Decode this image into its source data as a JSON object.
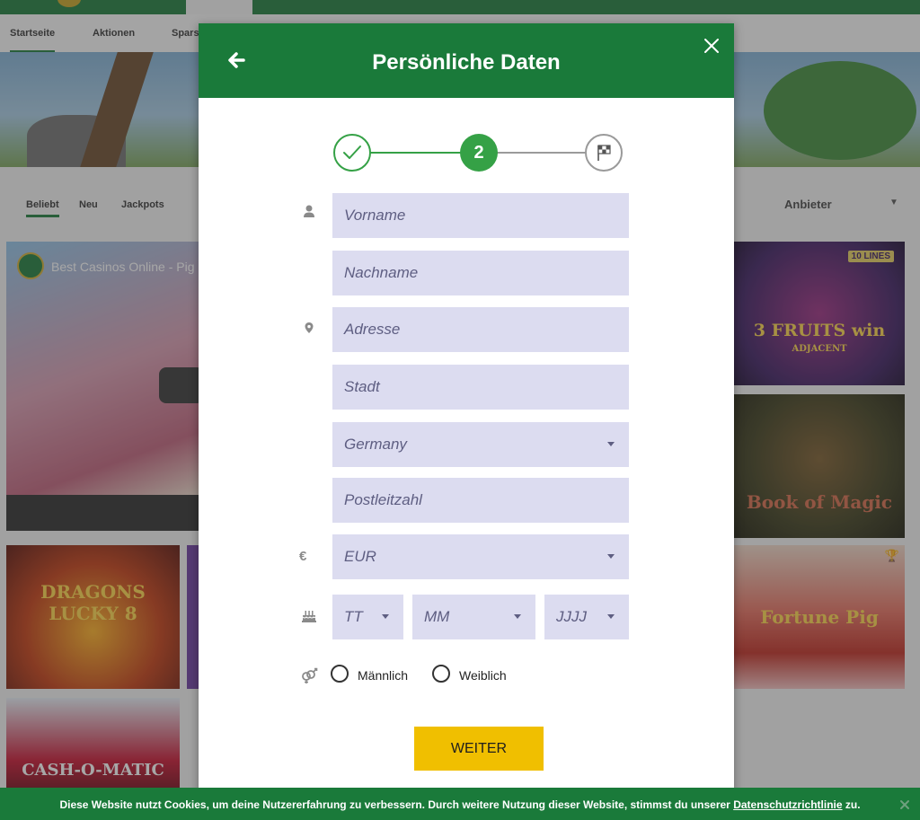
{
  "background": {
    "nav": [
      "Startseite",
      "Aktionen",
      "Spars"
    ],
    "filters": [
      "Beliebt",
      "Neu",
      "Jackpots"
    ],
    "provider_label": "Anbieter",
    "video_title": "Best Casinos Online - Pig",
    "tiles": {
      "fruits_badge": "10 LINES",
      "fruits_name": "3 FRUITS win",
      "fruits_sub": "ADJACENT",
      "book_name": "Book of Magic",
      "pig_name": "Fortune Pig",
      "dragon_name": "DRAGONS LUCKY 8",
      "cash_name": "CASH-O-MATIC"
    }
  },
  "modal": {
    "title": "Persönliche Daten",
    "stepper": {
      "current_step": "2",
      "total_steps": 3,
      "completed_steps": 1
    },
    "fields": {
      "firstname": "Vorname",
      "lastname": "Nachname",
      "address": "Adresse",
      "city": "Stadt",
      "country": "Germany",
      "zip": "Postleitzahl",
      "currency": "EUR",
      "currency_symbol": "€",
      "dob_day": "TT",
      "dob_month": "MM",
      "dob_year": "JJJJ"
    },
    "gender": {
      "male": "Männlich",
      "female": "Weiblich"
    },
    "submit_label": "WEITER"
  },
  "cookie": {
    "text_before": "Diese Website nutzt Cookies, um deine Nutzererfahrung zu verbessern. Durch weitere Nutzung dieser Website, stimmst du unserer ",
    "link": "Datenschutzrichtlinie",
    "text_after": " zu."
  },
  "colors": {
    "brand_green": "#1a7a3a",
    "step_green": "#35a146",
    "field_bg": "#dcdcf0",
    "button_yellow": "#f0bf00"
  }
}
